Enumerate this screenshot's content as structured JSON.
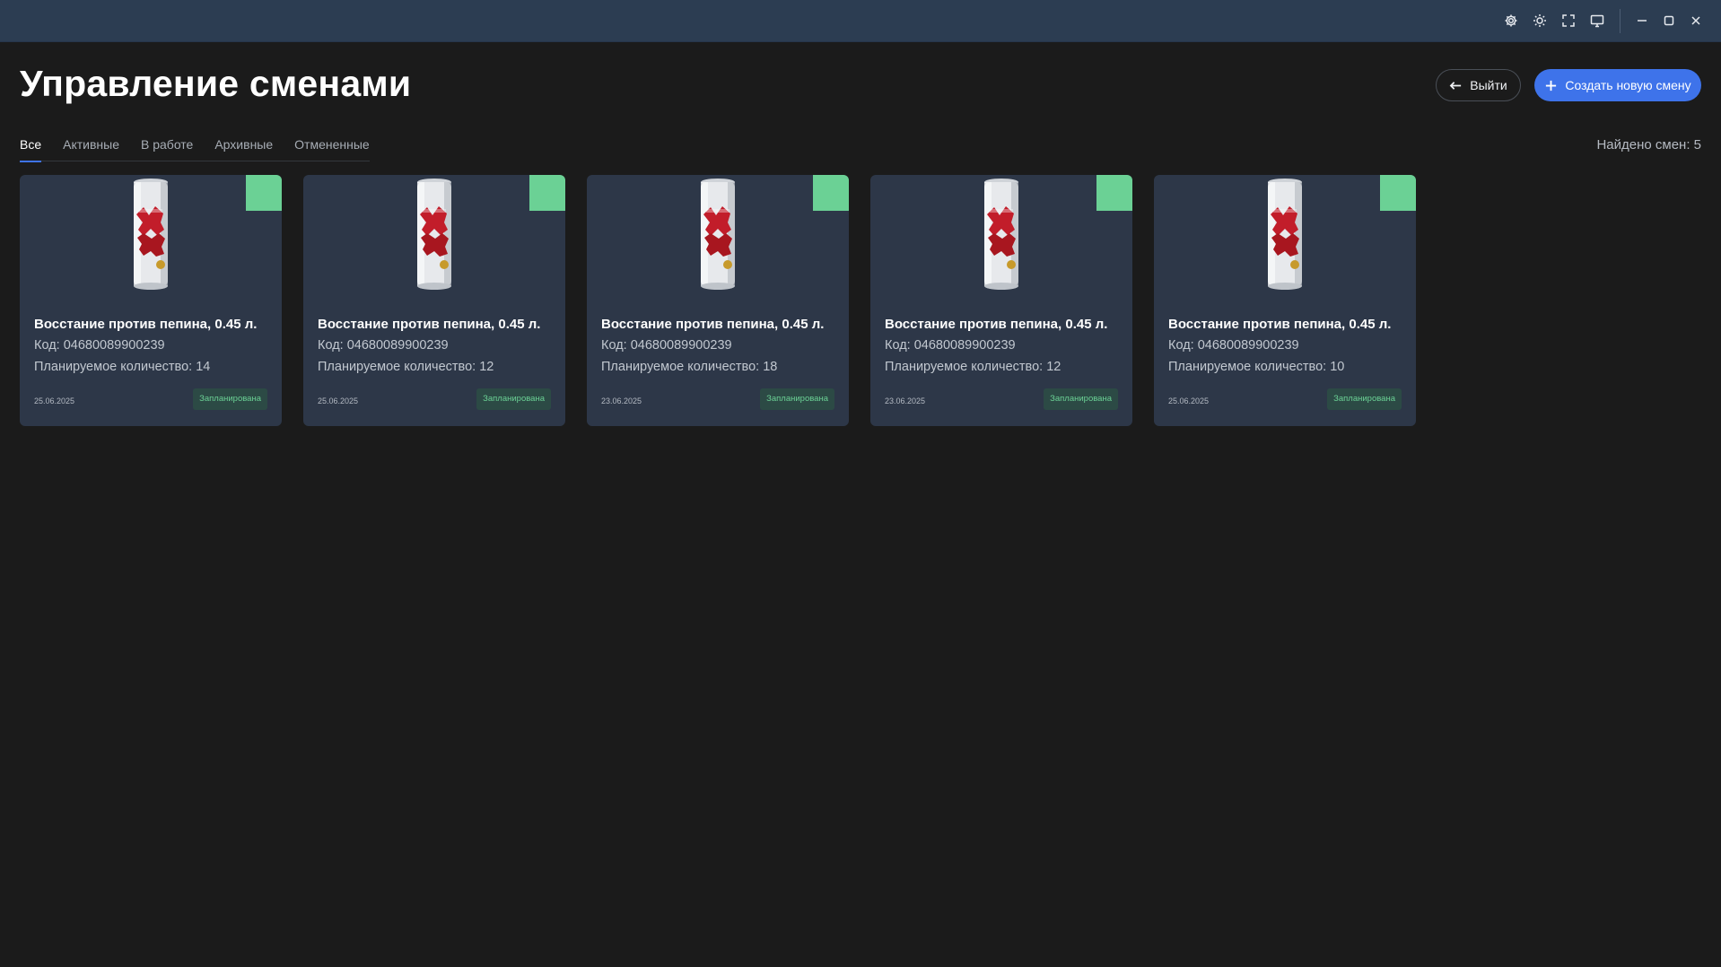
{
  "window_controls": {
    "icons": [
      "gear-icon",
      "sun-icon",
      "fullscreen-icon",
      "monitor-icon",
      "minimize-icon",
      "maximize-icon",
      "close-icon"
    ]
  },
  "header": {
    "title": "Управление сменами",
    "exit_label": "Выйти",
    "create_label": "Создать новую смену"
  },
  "tabs": [
    {
      "label": "Все",
      "active": true
    },
    {
      "label": "Активные",
      "active": false
    },
    {
      "label": "В работе",
      "active": false
    },
    {
      "label": "Архивные",
      "active": false
    },
    {
      "label": "Отмененные",
      "active": false
    }
  ],
  "found_count": "Найдено смен: 5",
  "cards": [
    {
      "title": "Восстание против пепина, 0.45 л.",
      "code": "Код: 04680089900239",
      "quantity": "Планируемое количество: 14",
      "date": "25.06.2025",
      "status": "Запланирована"
    },
    {
      "title": "Восстание против пепина, 0.45 л.",
      "code": "Код: 04680089900239",
      "quantity": "Планируемое количество: 12",
      "date": "25.06.2025",
      "status": "Запланирована"
    },
    {
      "title": "Восстание против пепина, 0.45 л.",
      "code": "Код: 04680089900239",
      "quantity": "Планируемое количество: 18",
      "date": "23.06.2025",
      "status": "Запланирована"
    },
    {
      "title": "Восстание против пепина, 0.45 л.",
      "code": "Код: 04680089900239",
      "quantity": "Планируемое количество: 12",
      "date": "23.06.2025",
      "status": "Запланирована"
    },
    {
      "title": "Восстание против пепина, 0.45 л.",
      "code": "Код: 04680089900239",
      "quantity": "Планируемое количество: 10",
      "date": "25.06.2025",
      "status": "Запланирована"
    }
  ],
  "colors": {
    "background": "#1b1b1b",
    "titlebar": "#2c3d52",
    "card": "#2d3748",
    "accent": "#3e73ea",
    "status_green": "#6bd195"
  }
}
